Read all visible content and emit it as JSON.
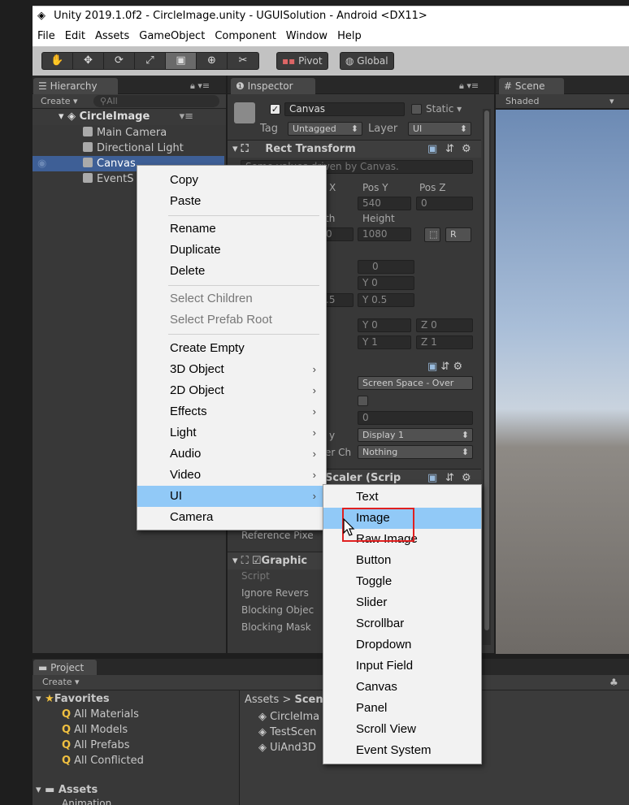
{
  "window": {
    "title": "Unity 2019.1.0f2 - CircleImage.unity - UGUISolution - Android <DX11>"
  },
  "menubar": [
    "File",
    "Edit",
    "Assets",
    "GameObject",
    "Component",
    "Window",
    "Help"
  ],
  "toolbar": {
    "tools": [
      "hand",
      "move",
      "rotate",
      "scale",
      "rect",
      "transform",
      "custom"
    ],
    "pivot_label": "Pivot",
    "global_label": "Global"
  },
  "hierarchy": {
    "tab": "Hierarchy",
    "create": "Create",
    "search_placeholder": "All",
    "scene_name": "CircleImage",
    "items": [
      "Main Camera",
      "Directional Light",
      "Canvas",
      "EventS"
    ]
  },
  "inspector": {
    "tab": "Inspector",
    "object_name": "Canvas",
    "static_label": "Static",
    "tag_label": "Tag",
    "tag_value": "Untagged",
    "layer_label": "Layer",
    "layer_value": "UI",
    "rect_transform": "Rect Transform",
    "driven_note": "Some values driven by Canvas.",
    "labels": {
      "posx": "X",
      "posy": "Pos Y",
      "posz": "Pos Z",
      "width": "th",
      "height": "Height"
    },
    "values": {
      "posy": "540",
      "posz": "0",
      "width": "0",
      "height": "1080",
      "anchor_min_y": "0",
      "anchor_max_y": "0",
      "pivot_x": ".5",
      "pivot_y": "0.5",
      "rot_y": "0",
      "rot_z": "0",
      "scale_y": "1",
      "scale_z": "1"
    },
    "canvas_render_mode": "Screen Space - Over",
    "sort_order": "0",
    "target_display_label": "y",
    "target_display": "Display 1",
    "additional_label": "er Ch",
    "additional_value": "Nothing",
    "canvas_scaler": "Scaler (Scrip",
    "reference_pixel": "Reference Pixe",
    "graphic_raycaster": "Graphic",
    "raycaster_fields": [
      "Script",
      "Ignore Revers",
      "Blocking Objec",
      "Blocking Mask"
    ],
    "xyz": {
      "y": "Y",
      "z": "Z"
    }
  },
  "scene": {
    "tab": "Scene",
    "shading": "Shaded"
  },
  "project": {
    "tab": "Project",
    "create": "Create",
    "favorites_label": "Favorites",
    "favorites": [
      "All Materials",
      "All Models",
      "All Prefabs",
      "All Conflicted"
    ],
    "assets_label": "Assets",
    "assets_sub": "Animation",
    "breadcrumb": "Assets",
    "breadcrumb_child": "Scen",
    "files": [
      "CircleIma",
      "TestScen",
      "UiAnd3D"
    ]
  },
  "context_menu": {
    "items": [
      {
        "label": "Copy"
      },
      {
        "label": "Paste"
      },
      {
        "label": "Rename"
      },
      {
        "label": "Duplicate"
      },
      {
        "label": "Delete"
      },
      {
        "label": "Select Children"
      },
      {
        "label": "Select Prefab Root"
      },
      {
        "label": "Create Empty"
      },
      {
        "label": "3D Object"
      },
      {
        "label": "2D Object"
      },
      {
        "label": "Effects"
      },
      {
        "label": "Light"
      },
      {
        "label": "Audio"
      },
      {
        "label": "Video"
      },
      {
        "label": "UI"
      },
      {
        "label": "Camera"
      }
    ],
    "arrow": "›"
  },
  "ui_submenu": {
    "items": [
      "Text",
      "Image",
      "Raw Image",
      "Button",
      "Toggle",
      "Slider",
      "Scrollbar",
      "Dropdown",
      "Input Field",
      "Canvas",
      "Panel",
      "Scroll View",
      "Event System"
    ]
  },
  "colors": {
    "highlight": "#91c9f7",
    "selection": "#3e5f96",
    "annotation_box": "#e02020"
  }
}
